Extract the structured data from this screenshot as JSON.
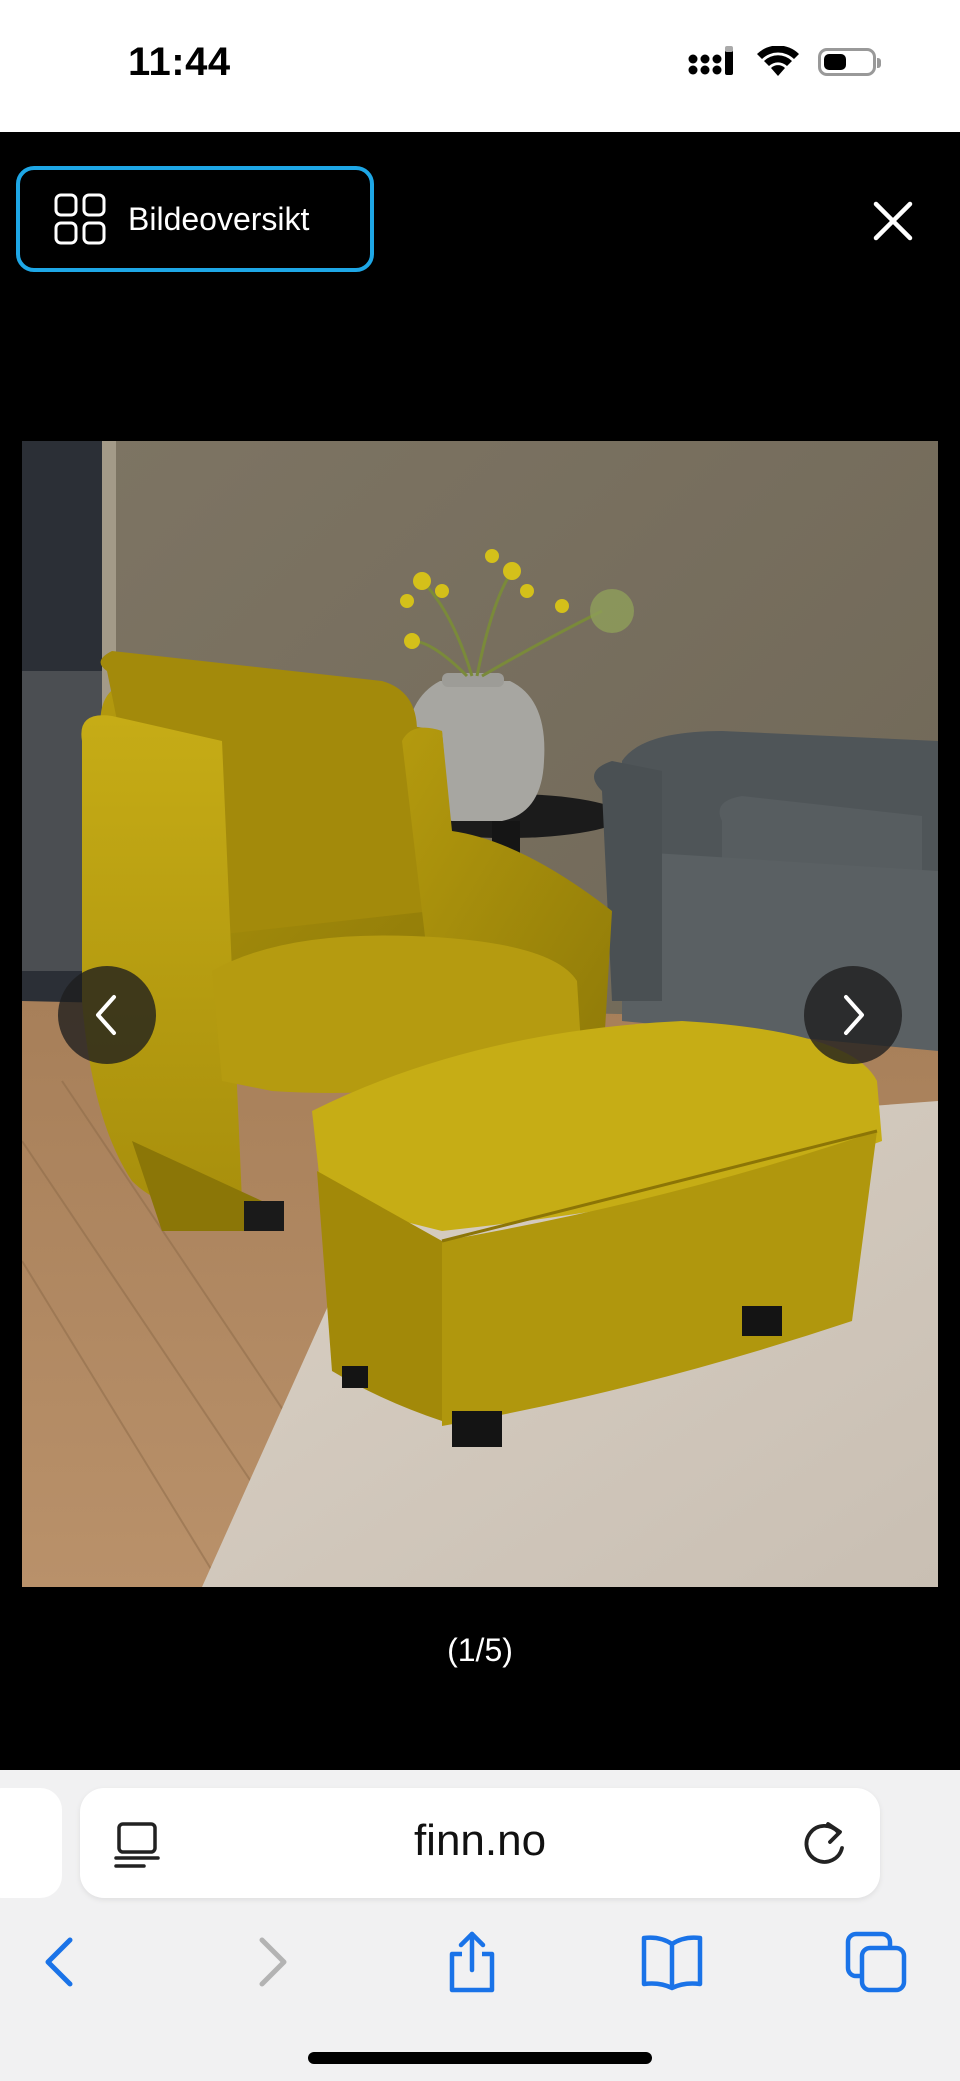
{
  "status_bar": {
    "time": "11:44",
    "icons": [
      "cellular-signal-icon",
      "wifi-icon",
      "battery-icon"
    ]
  },
  "viewer": {
    "overview_button": {
      "label": "Bildeoversikt",
      "icon": "grid-icon"
    },
    "close_icon": "close-icon",
    "photo": {
      "subject": "mustard yellow velvet armchair with matching footstool",
      "image_index": 1,
      "image_total": 5
    },
    "prev_icon": "chevron-left-icon",
    "next_icon": "chevron-right-icon",
    "counter": "(1/5)"
  },
  "browser": {
    "url": "finn.no",
    "reader_icon": "reader-mode-icon",
    "reload_icon": "reload-icon",
    "toolbar": [
      "back-icon",
      "forward-icon",
      "share-icon",
      "bookmarks-icon",
      "tabs-icon"
    ]
  },
  "colors": {
    "accent": "#1ea7e6",
    "safari_blue": "#1a73e8",
    "toolbar_bg": "#f1f1f2"
  }
}
